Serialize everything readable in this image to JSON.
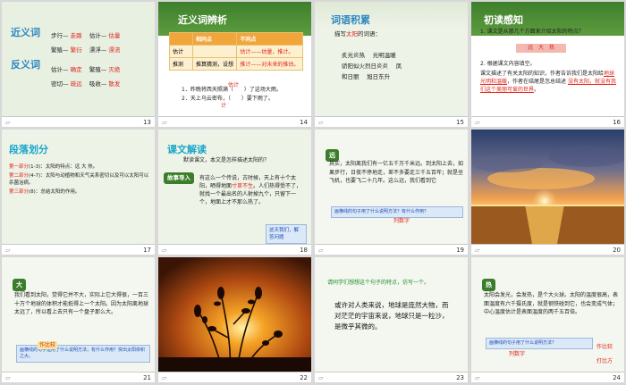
{
  "slides": {
    "s13": {
      "num": "13",
      "title_syn": "近义词",
      "title_ant": "反义词",
      "syn_rows": [
        [
          "步行",
          "走路",
          "估计",
          "估量"
        ],
        [
          "繁殖",
          "繁衍",
          "漂浮",
          "漂流"
        ]
      ],
      "ant_rows": [
        [
          "估计",
          "确定",
          "繁殖",
          "灭绝"
        ],
        [
          "密切",
          "疏远",
          "吸收",
          "散发"
        ]
      ]
    },
    "s14": {
      "num": "14",
      "title": "近义词辨析",
      "table": {
        "head": [
          "相同点",
          "不同点"
        ],
        "rows": [
          [
            "估计",
            "",
            "估计——估量，推计。"
          ],
          [
            "推测",
            "推算猜测，设想",
            "推计——对未来的推估。"
          ]
        ]
      },
      "q1": "1．昨晚将西天照满（　　）了这场大雨。",
      "q2": "2．天上乌云密布，（　　）要下雨了。",
      "ans1": "估计",
      "ans2": "计"
    },
    "s15": {
      "num": "15",
      "title": "词语积累",
      "prompt_pre": "描写",
      "prompt_key": "太阳",
      "prompt_post": "的词语：",
      "rows": [
        "炙光炎热　 光明温暖",
        "骄阳似火烈日炎炎　 凤",
        "和日丽　 旭日东升"
      ]
    },
    "s16": {
      "num": "16",
      "title": "初读感知",
      "q1": "1. 课文是从那几个方面来介绍太阳的特点？",
      "q1_ans": "远　大　热",
      "q2": "2. 根据课文内容填空。",
      "q2_body": "课文描述了有关太阳的知识，作者告诉我们是太阳给",
      "fill1": "地球光明和温暖",
      "fill1_post": "，作者在结尾是怎总结述",
      "fill2": "没有太阳，就没有我们这个美丽可爱的世界",
      "fill2_post": "。"
    },
    "s17": {
      "num": "17",
      "title": "段落划分",
      "parts": [
        {
          "label": "第一部分",
          "range": "(1-3)：",
          "text": "太阳的特点：远 大 热。"
        },
        {
          "label": "第二部分",
          "range": "(4-7)：",
          "text": "太阳与动植物和天气关系密切以及可以太阳可以杀菌治病。"
        },
        {
          "label": "第三部分",
          "range": "(8)：",
          "text": "总结太阳的作用。"
        }
      ]
    },
    "s18": {
      "num": "18",
      "title": "课文解读",
      "question": "默读课文，本文是怎样描述太阳的？",
      "tag": "故事导入",
      "body_pre": "有这么一个传说，古时候，天上有十个太阳，晒得地面",
      "body_key": "寸草不生",
      "body_post": "。人们热得受不了，就找一个最出名的人射掉九个，只留下一个，地面上才不那么热了。",
      "note": "这天我们，解答问题"
    },
    "s19": {
      "num": "19",
      "tag": "远",
      "body": "其实，太阳离我们有一亿五千万千米远。到太阳上去，如果步行，日夜不停地走，差不多要走三千五百年；就是坐飞机，也要飞二十几年。这么远，我们看到它",
      "callout": "列数字",
      "callout_body": "画横线的句子用了什么说明方法？有什么作用？"
    },
    "s20": {
      "num": "20"
    },
    "s21": {
      "num": "21",
      "tag": "大",
      "body": "我们看到太阳，觉得它并不大，实际上它大得很，一百三十万个地球的体积才能抵得上一个太阳。因为太阳离地球太远了，所以看上去只有一个盘子那么大。",
      "callout_lbl": "作比较",
      "callout_body": "画横线的句子运用了什么说明方法，有什么作用？突出太阳体积之大。"
    },
    "s22": {
      "num": "22"
    },
    "s23": {
      "num": "23",
      "prompt": "请同学们想想这个句子的特点，仿写一个。",
      "sentence": "或许对人类来说，地球是庞然大物，而对茫茫的宇宙来说，地球只是一粒沙，是微乎其微的。"
    },
    "s24": {
      "num": "24",
      "tag": "热",
      "body": "太阳会发光，会发热，是个大火球。太阳的温度很高，表面温度有六千摄氏度，就是钢铁碰到它，也会变成气体；中心温度估计是表面温度的两千五百倍。",
      "c1": "列数字",
      "c2": "作比较",
      "c3": "打比方",
      "callout_body": "画横线的句子用了什么说明方法？"
    }
  },
  "colors": {
    "slide_bg": "#ffffff",
    "title_blue": "#2e86c1",
    "red": "#e0261b",
    "green_header": "#3d7f2b"
  }
}
